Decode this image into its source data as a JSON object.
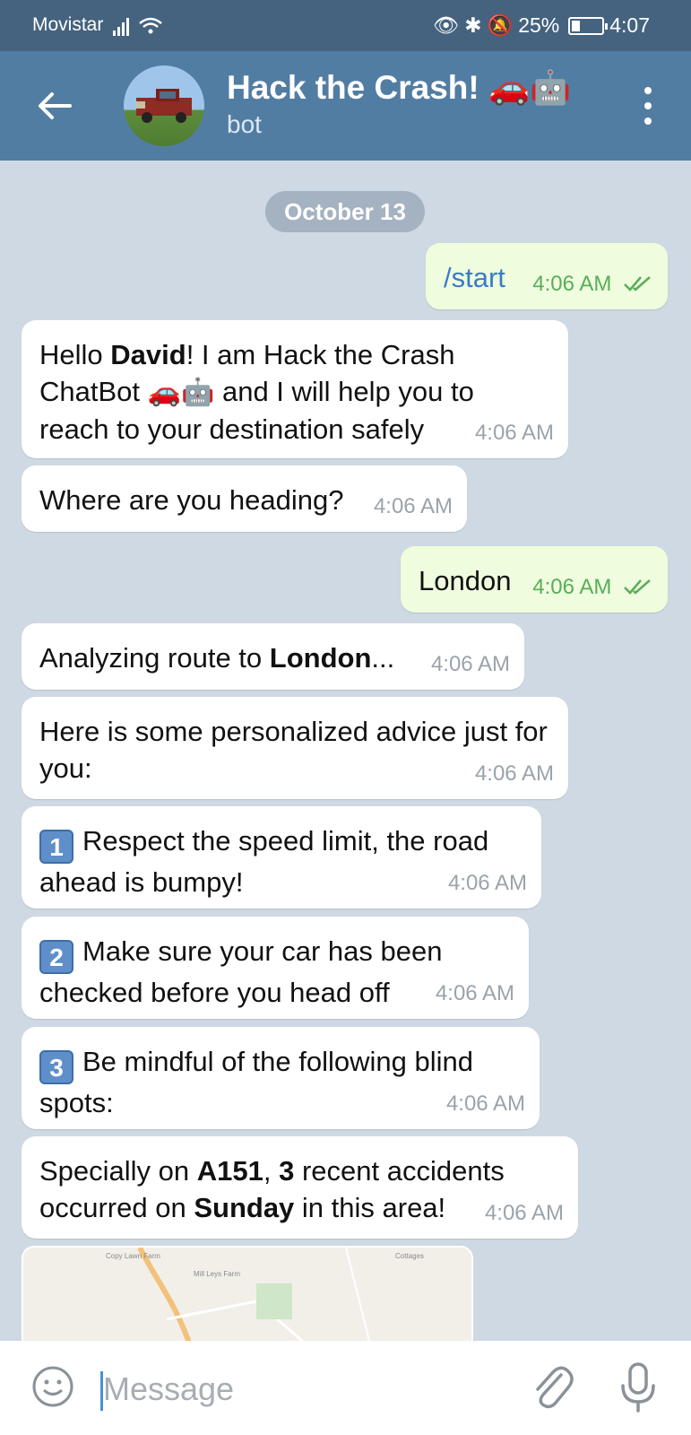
{
  "status_bar": {
    "carrier": "Movistar",
    "battery": "25%",
    "time": "4:07"
  },
  "header": {
    "title": "Hack the Crash! 🚗🤖",
    "subtitle": "bot"
  },
  "chat": {
    "date": "October 13",
    "messages": [
      {
        "dir": "out",
        "text": "/start",
        "time": "4:06 AM"
      },
      {
        "dir": "in",
        "p1": "Hello ",
        "b1": "David",
        "p2": "! I am Hack the Crash ChatBot ",
        "emoji": "🚗🤖",
        "p3": " and I will help you to reach to your destination safely",
        "time": "4:06 AM"
      },
      {
        "dir": "in",
        "text": "Where are you heading?",
        "time": "4:06 AM"
      },
      {
        "dir": "out",
        "text": "London",
        "time": "4:06 AM"
      },
      {
        "dir": "in",
        "p1": "Analyzing route to ",
        "b1": "London",
        "p2": "...",
        "time": "4:06 AM"
      },
      {
        "dir": "in",
        "text": "Here is some personalized advice just for you:",
        "time": "4:06 AM"
      },
      {
        "dir": "in",
        "num": "1",
        "text": "Respect the speed limit, the road ahead is bumpy!",
        "time": "4:06 AM"
      },
      {
        "dir": "in",
        "num": "2",
        "text": "Make sure your car has been checked before you head off",
        "time": "4:06 AM"
      },
      {
        "dir": "in",
        "num": "3",
        "text": "Be mindful of the following blind spots:",
        "time": "4:06 AM"
      },
      {
        "dir": "in",
        "p1": "Specially on ",
        "b1": "A151",
        "p2": ", ",
        "b2": "3",
        "p3": " recent accidents occurred on ",
        "b3": "Sunday",
        "p4": " in this area!",
        "time": "4:06 AM"
      }
    ],
    "map_labels": [
      "Copy Lawn Farm",
      "Mill Leys Farm",
      "Cottages"
    ]
  },
  "input": {
    "placeholder": "Message"
  }
}
